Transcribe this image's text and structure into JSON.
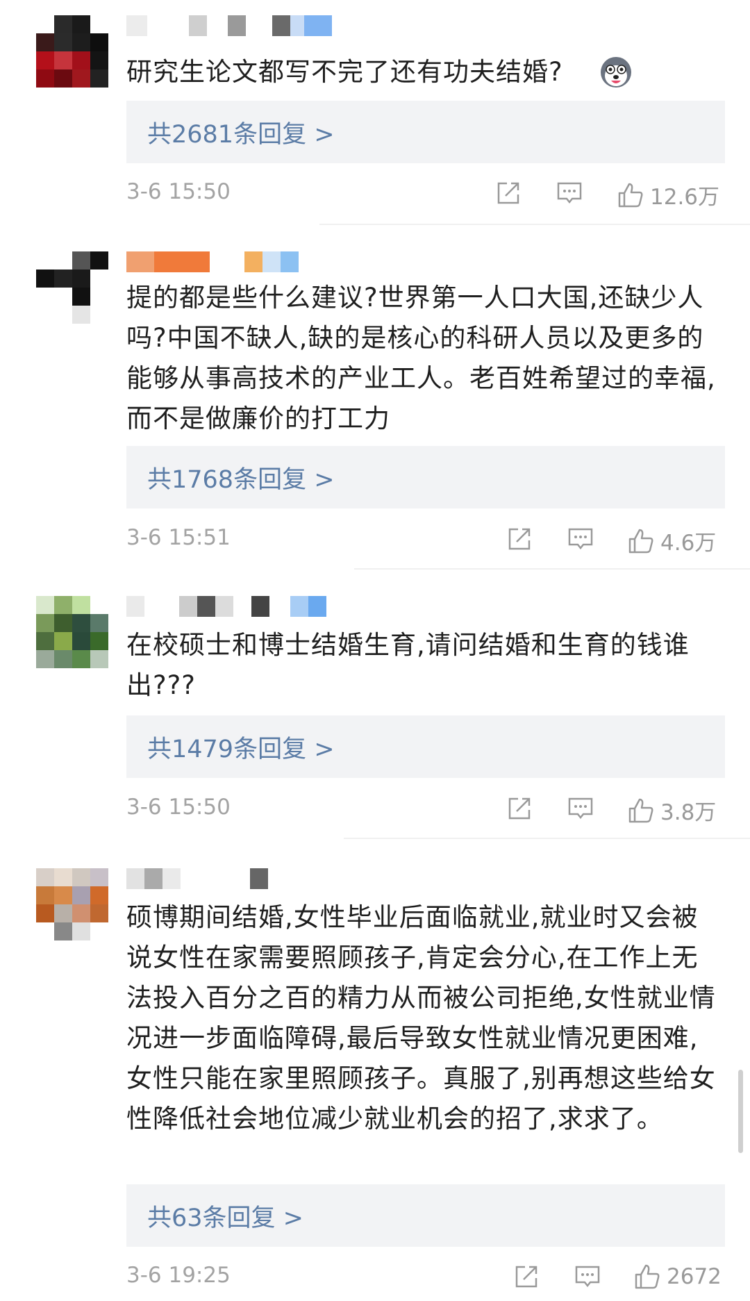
{
  "comments": [
    {
      "text": "研究生论文都写不完了还有功夫结婚?",
      "replies": "共2681条回复 >",
      "time": "3-6 15:50",
      "likes": "12.6万"
    },
    {
      "text": "提的都是些什么建议?世界第一人口大国,还缺少人吗?中国不缺人,缺的是核心的科研人员以及更多的能够从事高技术的产业工人。老百姓希望过的幸福,而不是做廉价的打工力",
      "replies": "共1768条回复 >",
      "time": "3-6 15:51",
      "likes": "4.6万"
    },
    {
      "text": "在校硕士和博士结婚生育,请问结婚和生育的钱谁出???",
      "replies": "共1479条回复 >",
      "time": "3-6 15:50",
      "likes": "3.8万"
    },
    {
      "text": "硕博期间结婚,女性毕业后面临就业,就业时又会被说女性在家需要照顾孩子,肯定会分心,在工作上无法投入百分之百的精力从而被公司拒绝,女性就业情况进一步面临障碍,最后导致女性就业情况更困难,女性只能在家里照顾孩子。真服了,别再想这些给女性降低社会地位减少就业机会的招了,求求了。",
      "replies": "共63条回复 >",
      "time": "3-6 19:25",
      "likes": "2672"
    }
  ],
  "colors": {
    "reply_link": "#5b7ca6",
    "reply_bg": "#f2f3f5",
    "meta_gray": "#a3a3a3"
  },
  "icons": [
    "share-icon",
    "comment-icon",
    "like-thumb-icon"
  ]
}
